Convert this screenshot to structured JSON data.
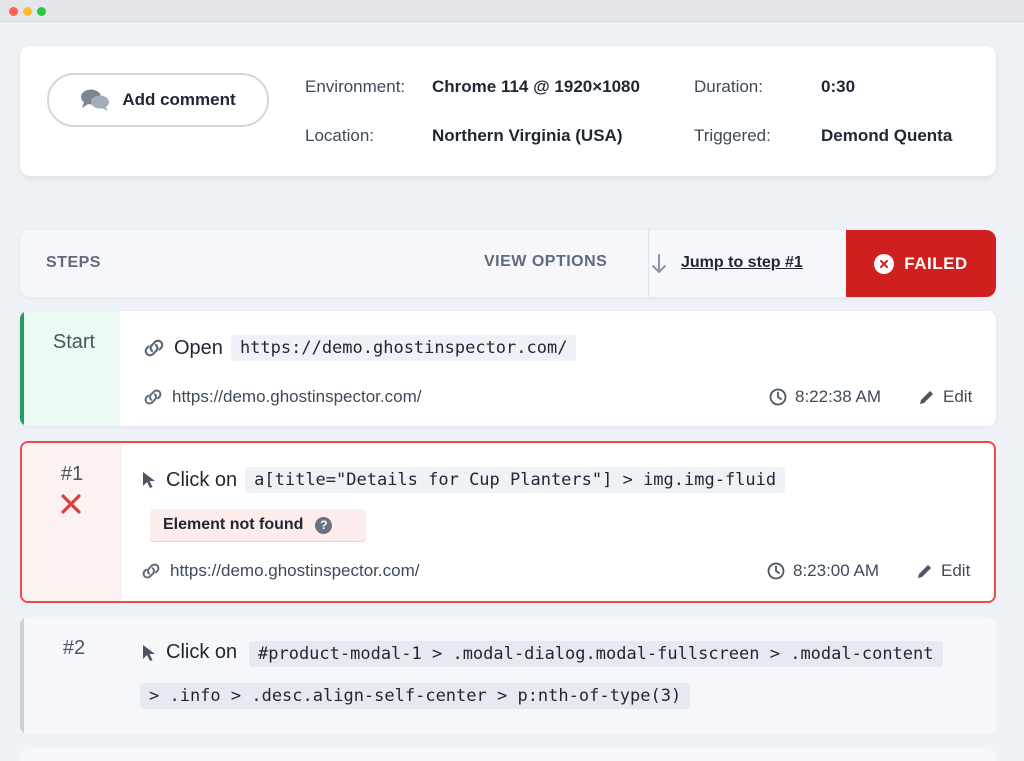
{
  "window": {
    "controls": [
      "close",
      "minimize",
      "maximize"
    ]
  },
  "header": {
    "add_comment_label": "Add comment",
    "environment_label": "Environment:",
    "environment_value": "Chrome 114 @ 1920×1080",
    "location_label": "Location:",
    "location_value": "Northern Virginia (USA)",
    "duration_label": "Duration:",
    "duration_value": "0:30",
    "triggered_label": "Triggered:",
    "triggered_value": "Demond Quenta"
  },
  "steps_bar": {
    "title": "STEPS",
    "view_options": "VIEW OPTIONS",
    "jump_link": "Jump to step #1",
    "status": "FAILED"
  },
  "steps": [
    {
      "number": "Start",
      "action": "Open",
      "selector": "https://demo.ghostinspector.com/",
      "url": "https://demo.ghostinspector.com/",
      "time": "8:22:38 AM",
      "edit_label": "Edit"
    },
    {
      "number": "#1",
      "action": "Click on",
      "selector": "a[title=\"Details for Cup Planters\"] > img.img-fluid",
      "error": "Element not found",
      "error_help": "?",
      "url": "https://demo.ghostinspector.com/",
      "time": "8:23:00 AM",
      "edit_label": "Edit"
    },
    {
      "number": "#2",
      "action": "Click on",
      "selector_line1": "#product-modal-1 > .modal-dialog.modal-fullscreen > .modal-content",
      "selector_line2": "> .info > .desc.align-self-center > p:nth-of-type(3)"
    }
  ],
  "colors": {
    "failed": "#d01f1f",
    "success_border": "#1f9d62",
    "error_border": "#ef4a4a",
    "background": "#eef1f6"
  }
}
